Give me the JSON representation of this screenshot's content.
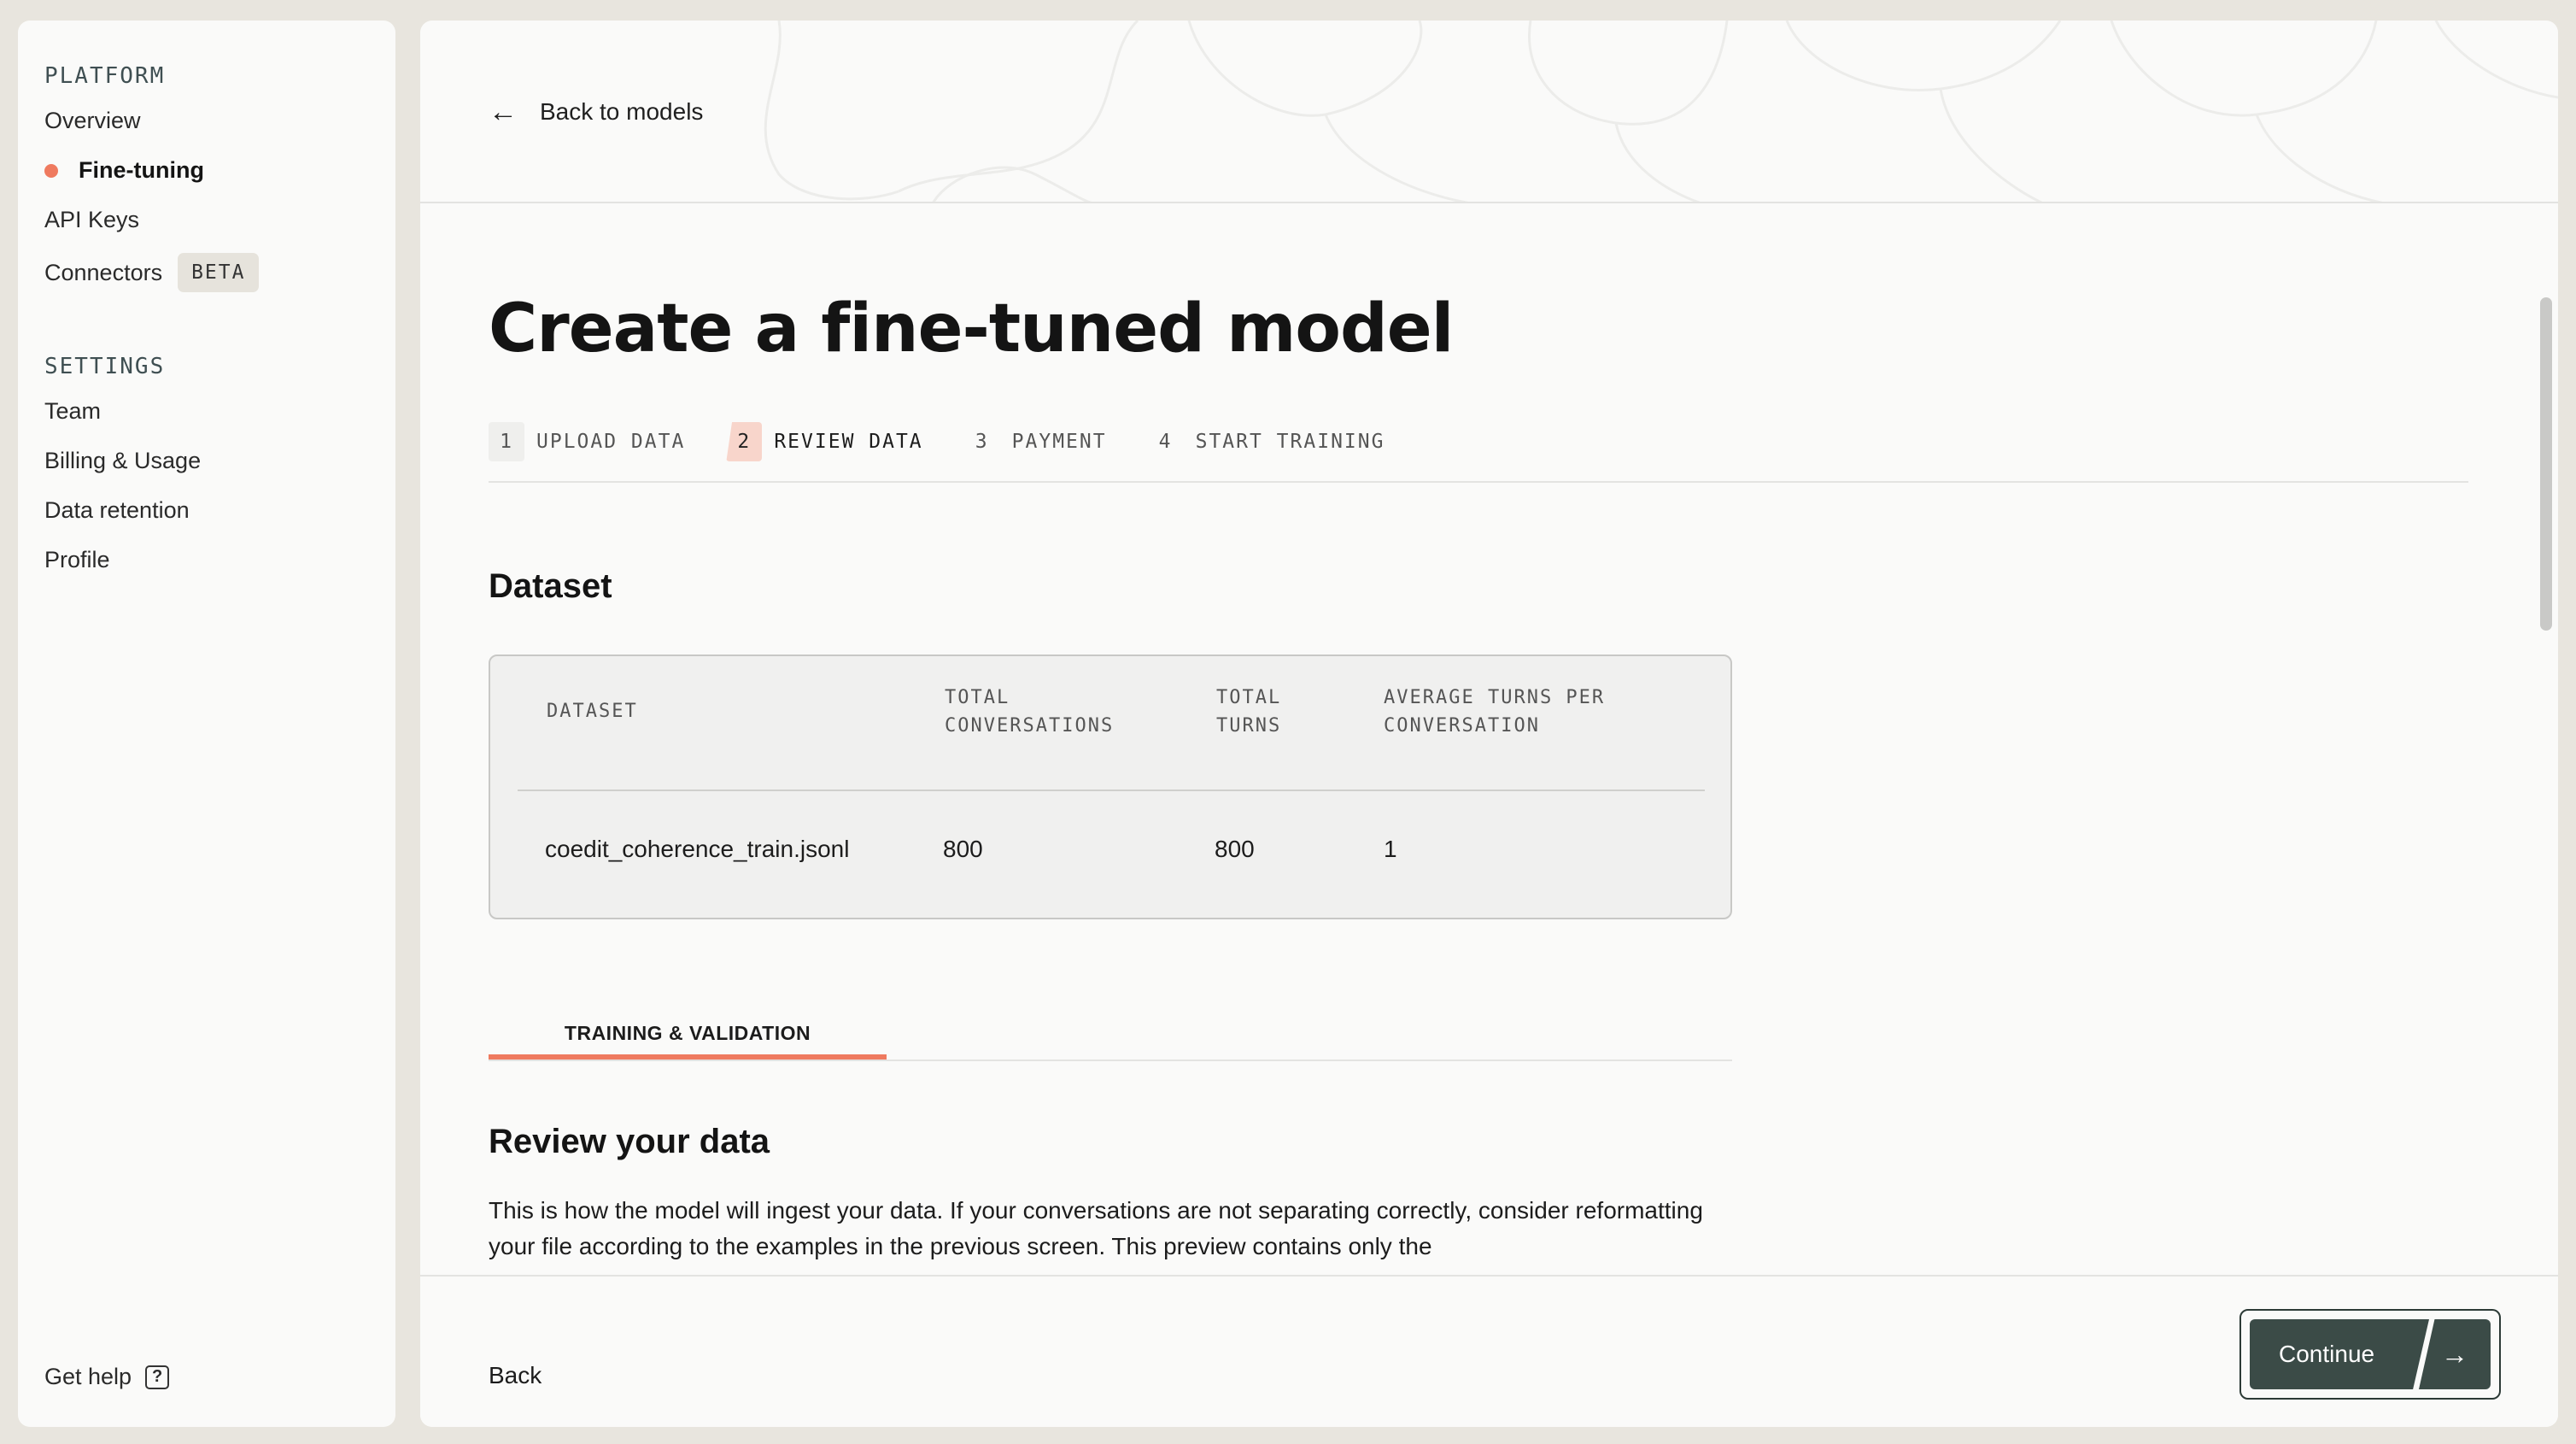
{
  "sidebar": {
    "platform_title": "PLATFORM",
    "platform_items": [
      {
        "label": "Overview"
      },
      {
        "label": "Fine-tuning",
        "active": true
      },
      {
        "label": "API Keys"
      },
      {
        "label": "Connectors",
        "badge": "BETA"
      }
    ],
    "settings_title": "SETTINGS",
    "settings_items": [
      {
        "label": "Team"
      },
      {
        "label": "Billing & Usage"
      },
      {
        "label": "Data retention"
      },
      {
        "label": "Profile"
      }
    ],
    "help_label": "Get help",
    "help_icon": "?"
  },
  "header": {
    "back_label": "Back to models",
    "back_icon": "←"
  },
  "page_title": "Create a fine-tuned model",
  "steps": [
    {
      "num": "1",
      "label": "UPLOAD DATA",
      "state": "done"
    },
    {
      "num": "2",
      "label": "REVIEW DATA",
      "state": "current"
    },
    {
      "num": "3",
      "label": "PAYMENT",
      "state": "upcoming"
    },
    {
      "num": "4",
      "label": "START TRAINING",
      "state": "upcoming"
    }
  ],
  "dataset": {
    "section_title": "Dataset",
    "headers": [
      "DATASET",
      "TOTAL CONVERSATIONS",
      "TOTAL TURNS",
      "AVERAGE TURNS PER CONVERSATION"
    ],
    "row": [
      "coedit_coherence_train.jsonl",
      "800",
      "800",
      "1"
    ]
  },
  "tabs": {
    "active": "TRAINING & VALIDATION"
  },
  "review": {
    "title": "Review your data",
    "text": "This is how the model will ingest your data. If your conversations are not separating correctly, consider reformatting your file according to the examples in the previous screen. This preview contains only the"
  },
  "footer": {
    "back_label": "Back",
    "continue_label": "Continue",
    "continue_icon": "→"
  },
  "colors": {
    "accent": "#ef7a5f",
    "button": "#3b4b47",
    "background": "#e8e5de"
  }
}
